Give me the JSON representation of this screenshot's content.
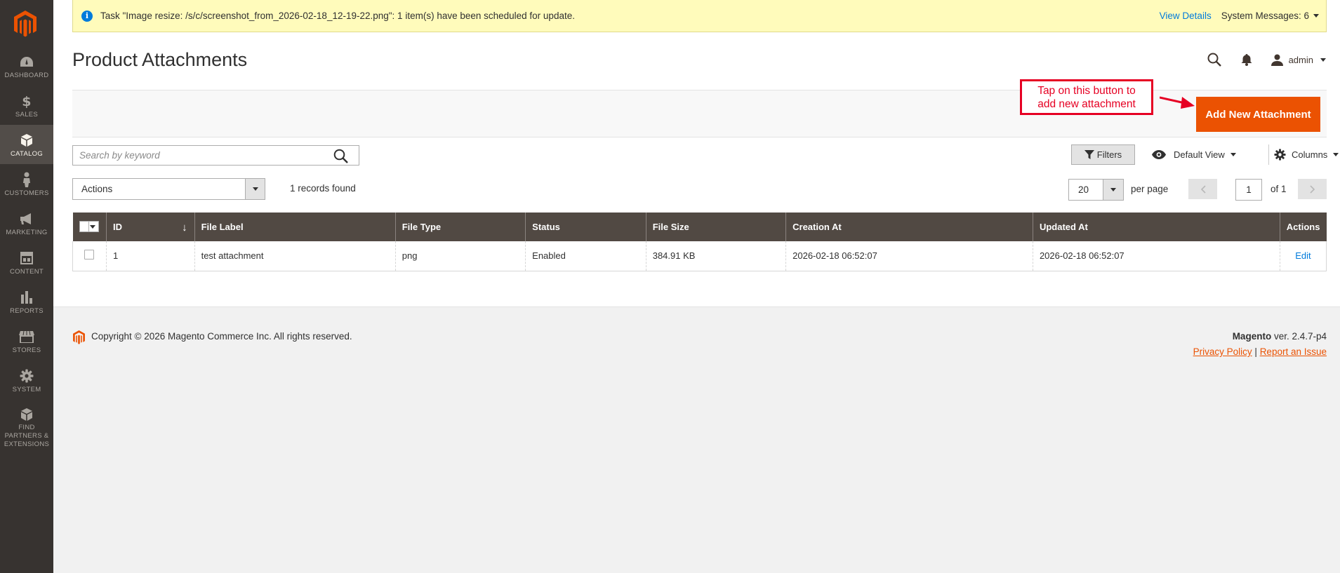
{
  "sidebar": {
    "logo": "magento-logo",
    "items": [
      {
        "label": "DASHBOARD",
        "icon": "dashboard-icon"
      },
      {
        "label": "SALES",
        "icon": "dollar-icon"
      },
      {
        "label": "CATALOG",
        "icon": "box-icon",
        "active": true
      },
      {
        "label": "CUSTOMERS",
        "icon": "person-icon"
      },
      {
        "label": "MARKETING",
        "icon": "megaphone-icon"
      },
      {
        "label": "CONTENT",
        "icon": "layout-icon"
      },
      {
        "label": "REPORTS",
        "icon": "bar-chart-icon"
      },
      {
        "label": "STORES",
        "icon": "store-icon"
      },
      {
        "label": "SYSTEM",
        "icon": "gear-icon"
      },
      {
        "label": "FIND PARTNERS & EXTENSIONS",
        "icon": "cubes-icon"
      }
    ]
  },
  "notice": {
    "message": "Task \"Image resize: /s/c/screenshot_from_2026-02-18_12-19-22.png\": 1 item(s) have been scheduled for update.",
    "view_details": "View Details",
    "system_messages": "System Messages: 6"
  },
  "header": {
    "title": "Product Attachments",
    "user": "admin"
  },
  "page_actions": {
    "add_button": "Add New Attachment"
  },
  "annotation": {
    "line1": "Tap on this button to",
    "line2": "add new attachment"
  },
  "toolbar": {
    "search_placeholder": "Search by keyword",
    "filters": "Filters",
    "view": "Default View",
    "columns": "Columns",
    "actions": "Actions",
    "records": "1 records found",
    "per_page_value": "20",
    "per_page_label": "per page",
    "current_page": "1",
    "of_pages": "of 1"
  },
  "grid": {
    "columns": [
      "ID",
      "File Label",
      "File Type",
      "Status",
      "File Size",
      "Creation At",
      "Updated At",
      "Actions"
    ],
    "rows": [
      {
        "id": "1",
        "file_label": "test attachment",
        "file_type": "png",
        "status": "Enabled",
        "file_size": "384.91 KB",
        "created_at": "2026-02-18 06:52:07",
        "updated_at": "2026-02-18 06:52:07",
        "action": "Edit"
      }
    ]
  },
  "footer": {
    "copyright": "Copyright © 2026 Magento Commerce Inc. All rights reserved.",
    "brand": "Magento",
    "version": " ver. 2.4.7-p4",
    "privacy": "Privacy Policy",
    "separator": " | ",
    "report": "Report an Issue"
  },
  "colors": {
    "sidebar_bg": "#373330",
    "brand_orange": "#eb5202",
    "notice_bg": "#fffbbb",
    "grid_header": "#514943",
    "link_blue": "#007bdb",
    "annotation_red": "#e60023"
  }
}
